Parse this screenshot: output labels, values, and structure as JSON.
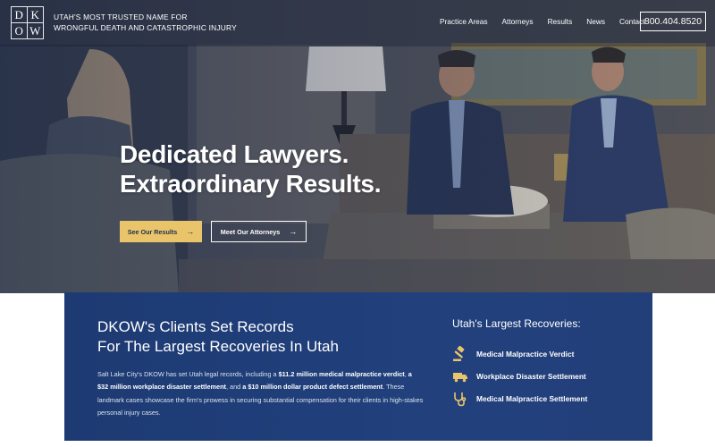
{
  "brand": {
    "logo_letters": [
      "D",
      "K",
      "O",
      "W"
    ],
    "tagline_line1": "UTAH'S MOST TRUSTED NAME FOR",
    "tagline_line2": "WRONGFUL DEATH AND CATASTROPHIC INJURY"
  },
  "nav": {
    "items": [
      "Practice Areas",
      "Attorneys",
      "Results",
      "News",
      "Contact"
    ],
    "phone": "800.404.8520"
  },
  "hero": {
    "headline_line1": "Dedicated Lawyers.",
    "headline_line2": "Extraordinary Results.",
    "primary_button": "See Our Results",
    "secondary_button": "Meet Our Attorneys"
  },
  "records": {
    "title_line1": "DKOW's Clients Set Records",
    "title_line2": "For The Largest Recoveries In Utah",
    "body_intro": "Salt Lake City's DKOW has set Utah legal records, including a ",
    "body_bold1": "$11.2 million medical malpractice verdict",
    "body_sep1": ", ",
    "body_bold2": "a $32 million workplace disaster settlement",
    "body_sep2": ", and ",
    "body_bold3": "a $10 million dollar product defect settlement",
    "body_rest": ". These landmark cases showcase the firm's prowess in securing substantial compensation for their clients in high-stakes personal injury cases."
  },
  "recoveries": {
    "title": "Utah's Largest Recoveries:",
    "items": [
      {
        "label": "Medical Malpractice Verdict",
        "icon": "gavel-icon"
      },
      {
        "label": "Workplace Disaster Settlement",
        "icon": "truck-icon"
      },
      {
        "label": "Medical Malpractice Settlement",
        "icon": "stethoscope-icon"
      }
    ]
  },
  "colors": {
    "navy": "#1d3a73",
    "gold": "#e9c46a"
  }
}
